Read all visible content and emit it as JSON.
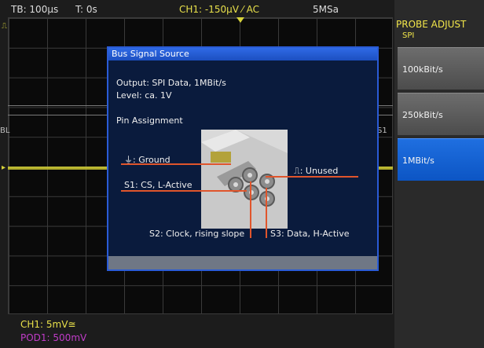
{
  "status": {
    "timebase": "TB: 100µs",
    "trigger_time": "T: 0s",
    "channel_info": "CH1: -150µV ⁄ AC",
    "sample_rate": "5MSa"
  },
  "side_labels": {
    "left": "BL",
    "right": "S1"
  },
  "footer": {
    "ch1": "CH1: 5mV≅",
    "pod1": "POD1: 500mV"
  },
  "menu": {
    "title": "PROBE ADJUST",
    "subtitle": "SPI",
    "items": [
      {
        "label": "100kBit/s",
        "active": false
      },
      {
        "label": "250kBit/s",
        "active": false
      },
      {
        "label": "1MBit/s",
        "active": true
      }
    ]
  },
  "dialog": {
    "title": "Bus Signal Source",
    "output": "Output: SPI Data,  1MBit/s",
    "level": "Level: ca. 1V",
    "pin_heading": "Pin Assignment",
    "pins": {
      "ground": "⏚: Ground",
      "s1": "S1: CS, L-Active",
      "unused": "⎍: Unused",
      "s2": "S2: Clock, rising slope",
      "s3": "S3: Data, H-Active"
    }
  },
  "colors": {
    "accent": "#1f6fe0",
    "trace": "#d6d23a",
    "pin_line": "#e0552c",
    "menu_title": "#f2e64a",
    "pod_text": "#c03cc8"
  }
}
